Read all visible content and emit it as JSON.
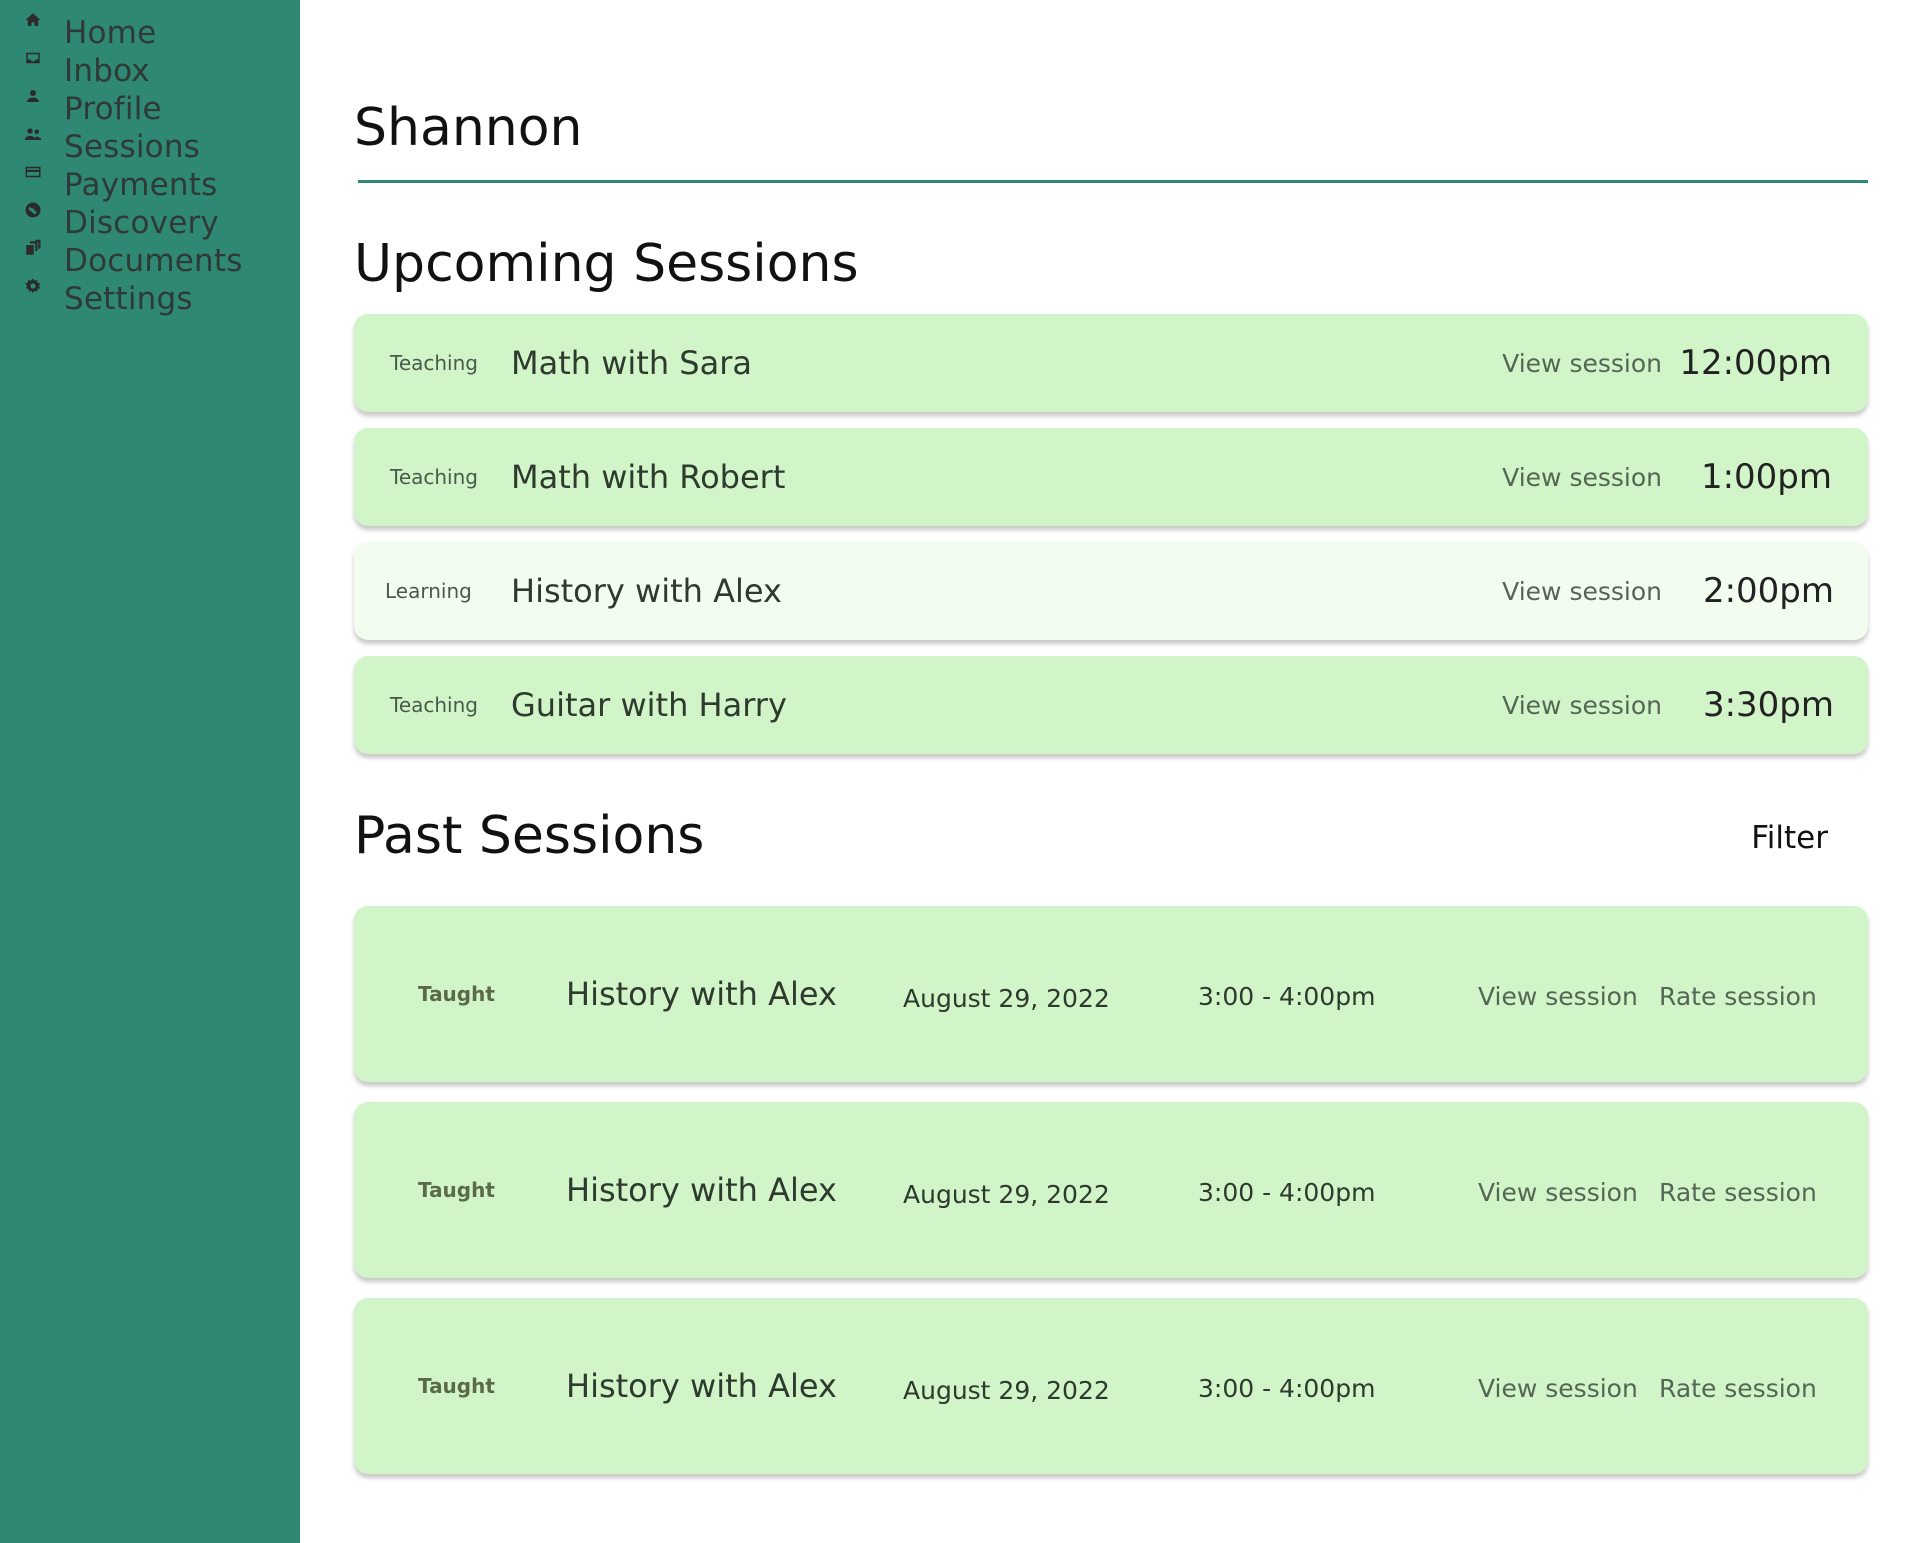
{
  "sidebar": {
    "background": "#2f8873",
    "items": [
      {
        "label": "Home",
        "icon": "home-icon"
      },
      {
        "label": "Inbox",
        "icon": "inbox-icon"
      },
      {
        "label": "Profile",
        "icon": "person-icon"
      },
      {
        "label": "Sessions",
        "icon": "people-icon"
      },
      {
        "label": "Payments",
        "icon": "credit-card-icon"
      },
      {
        "label": "Discovery",
        "icon": "globe-icon"
      },
      {
        "label": "Documents",
        "icon": "documents-icon"
      },
      {
        "label": "Settings",
        "icon": "gear-icon"
      }
    ]
  },
  "main": {
    "title": "Shannon",
    "accent_color": "#2f8873",
    "upcoming": {
      "title": "Upcoming Sessions",
      "items": [
        {
          "role": "Teaching",
          "name": "Math with Sara",
          "action": "View session",
          "time": "12:00pm",
          "color": "#d1f5c8"
        },
        {
          "role": "Teaching",
          "name": "Math with Robert",
          "action": "View session",
          "time": "1:00pm",
          "color": "#d1f5c8"
        },
        {
          "role": "Learning",
          "name": "History with Alex",
          "action": "View session",
          "time": "2:00pm",
          "color": "#f2fcef"
        },
        {
          "role": "Teaching",
          "name": "Guitar with Harry",
          "action": "View session",
          "time": "3:30pm",
          "color": "#d1f5c8"
        }
      ]
    },
    "past": {
      "title": "Past Sessions",
      "filter_label": "Filter",
      "items": [
        {
          "role": "Taught",
          "name": "History with Alex",
          "date": "August 29, 2022",
          "time": "3:00 - 4:00pm",
          "view": "View session",
          "rate": "Rate session"
        },
        {
          "role": "Taught",
          "name": "History with Alex",
          "date": "August 29, 2022",
          "time": "3:00 - 4:00pm",
          "view": "View session",
          "rate": "Rate session"
        },
        {
          "role": "Taught",
          "name": "History with Alex",
          "date": "August 29, 2022",
          "time": "3:00 - 4:00pm",
          "view": "View session",
          "rate": "Rate session"
        }
      ]
    }
  }
}
